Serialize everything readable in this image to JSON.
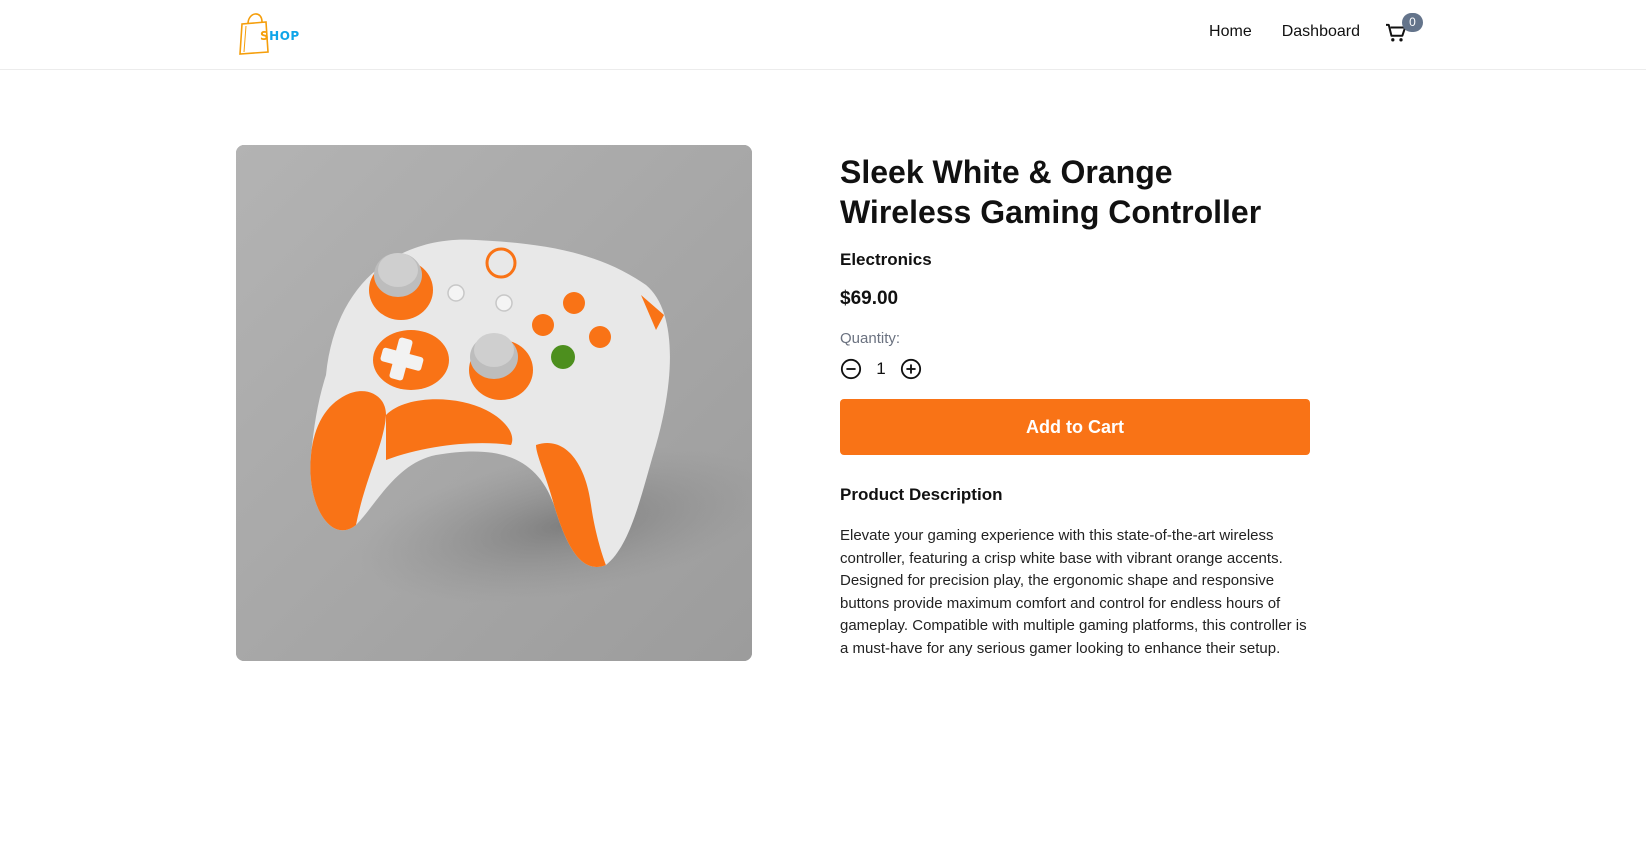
{
  "header": {
    "logo": {
      "brand_first": "S",
      "brand_rest": "HOP"
    },
    "nav": {
      "home": "Home",
      "dashboard": "Dashboard"
    },
    "cart": {
      "count": "0",
      "icon": "cart-icon"
    }
  },
  "product": {
    "image": {
      "icon": "gaming-controller-image"
    },
    "title": "Sleek White & Orange Wireless Gaming Controller",
    "category": "Electronics",
    "price": "$69.00",
    "quantity_label": "Quantity:",
    "quantity": "1",
    "add_to_cart_label": "Add to Cart",
    "description_title": "Product Description",
    "description": "Elevate your gaming experience with this state-of-the-art wireless controller, featuring a crisp white base with vibrant orange accents. Designed for precision play, the ergonomic shape and responsive buttons provide maximum comfort and control for endless hours of gameplay. Compatible with multiple gaming platforms, this controller is a must-have for any serious gamer looking to enhance their setup."
  },
  "colors": {
    "accent": "#f97316",
    "badge": "#64748b",
    "logo_orange": "#f59e0b",
    "logo_blue": "#0ea5e9"
  }
}
